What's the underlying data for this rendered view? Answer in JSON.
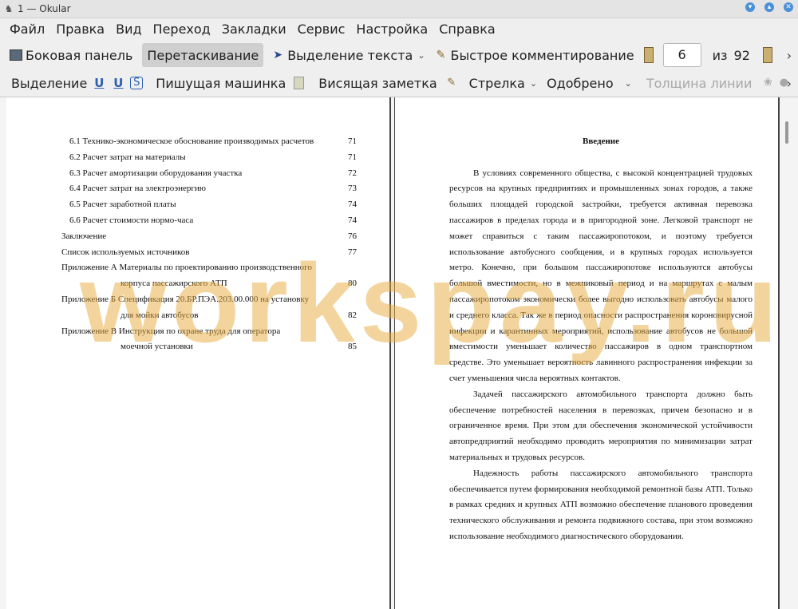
{
  "window": {
    "title": "1  — Okular"
  },
  "menu": [
    "Файл",
    "Правка",
    "Вид",
    "Переход",
    "Закладки",
    "Сервис",
    "Настройка",
    "Справка"
  ],
  "toolbar1": {
    "sidebar": "Боковая панель",
    "drag": "Перетаскивание",
    "text_select": "Выделение текста",
    "quick_comment": "Быстрое комментирование",
    "page_current": "6",
    "page_of": "из",
    "page_total": "92"
  },
  "toolbar2": {
    "highlight": "Выделение",
    "u1": "U",
    "u2": "U",
    "typewriter": "Пишущая машинка",
    "popup_note": "Висящая заметка",
    "arrow": "Стрелка",
    "stamp": "Одобрено",
    "line_width": "Толщина линии"
  },
  "toc": [
    {
      "text": "6.1 Технико-экономическое обоснование производимых расчетов",
      "page": "71",
      "indent": 1
    },
    {
      "text": "6.2 Расчет затрат на материалы",
      "page": "71",
      "indent": 1
    },
    {
      "text": "6.3 Расчет амортизации оборудования участка",
      "page": "72",
      "indent": 1
    },
    {
      "text": "6.4 Расчет затрат на электроэнергию",
      "page": "73",
      "indent": 1
    },
    {
      "text": "6.5 Расчет заработной платы",
      "page": "74",
      "indent": 1
    },
    {
      "text": "6.6 Расчет стоимости нормо-часа",
      "page": "74",
      "indent": 1
    },
    {
      "text": "Заключение",
      "page": "76",
      "indent": 0
    },
    {
      "text": "Список используемых источников",
      "page": "77",
      "indent": 0
    },
    {
      "text": "Приложение А Материалы по проектированию производственного",
      "page": "",
      "indent": 0
    },
    {
      "text": "корпуса пассажирского АТП",
      "page": "80",
      "indent": 2
    },
    {
      "text": "Приложение Б Спецификация 20.БР.ПЭА.203.00.000 на установку",
      "page": "",
      "indent": 0
    },
    {
      "text": "для мойки автобусов",
      "page": "82",
      "indent": 2
    },
    {
      "text": "Приложение В Инструкция по охране труда для оператора",
      "page": "",
      "indent": 0
    },
    {
      "text": "моечной установки",
      "page": "85",
      "indent": 2
    }
  ],
  "doc": {
    "heading": "Введение",
    "paragraphs": [
      "В условиях современного общества, с высокой концентрацией трудовых ресурсов на крупных предприятиях и промышленных зонах городов, а также больших площадей городской застройки, требуется активная перевозка пассажиров в пределах города и в пригородной зоне. Легковой транспорт не может справиться с таким пассажиропотоком, и поэтому требуется использование автобусного сообщения, и в крупных городах используется метро. Конечно, при большом пассажиропотоке используются автобусы большой вместимости, но в межпиковый период и на маршрутах с малым пассажиропотоком экономически более выгодно использовать автобусы малого и среднего класса. Так же в период опасности распространения короновирусной инфекции и карантинных мероприятий, использование автобусов не большой вместимости уменьшает количество пассажиров в одном транспортном средстве. Это уменьшает вероятность лавинного распространения инфекции за счет уменьшения числа вероятных контактов.",
      "Задачей пассажирского автомобильного транспорта должно быть обеспечение потребностей населения в перевозках, причем безопасно и в ограниченное время. При этом для обеспечения экономической устойчивости автопредприятий необходимо проводить мероприятия по минимизации затрат материальных и трудовых ресурсов.",
      "Надежность работы пассажирского автомобильного транспорта обеспечивается путем формирования необходимой ремонтной базы АТП. Только в рамках средних и крупных АТП возможно обеспечение планового проведения технического обслуживания и ремонта подвижного состава, при этом возможно использование необходимого диагностического оборудования."
    ]
  },
  "watermark": "workspay.ru",
  "icons": {
    "app": "okular-icon",
    "minimize": "minimize-icon",
    "maximize": "maximize-icon",
    "close": "close-icon",
    "sidebar": "sidebar-icon",
    "cursor": "cursor-icon",
    "pen": "pen-icon",
    "page_prev": "page-prev-icon",
    "page_next": "page-next-icon",
    "note": "note-icon",
    "overflow": "chevron-right-icon"
  },
  "colors": {
    "accent": "#2b5fb0",
    "watermark": "#e8aa3c",
    "window_button": "#4a90d9"
  }
}
